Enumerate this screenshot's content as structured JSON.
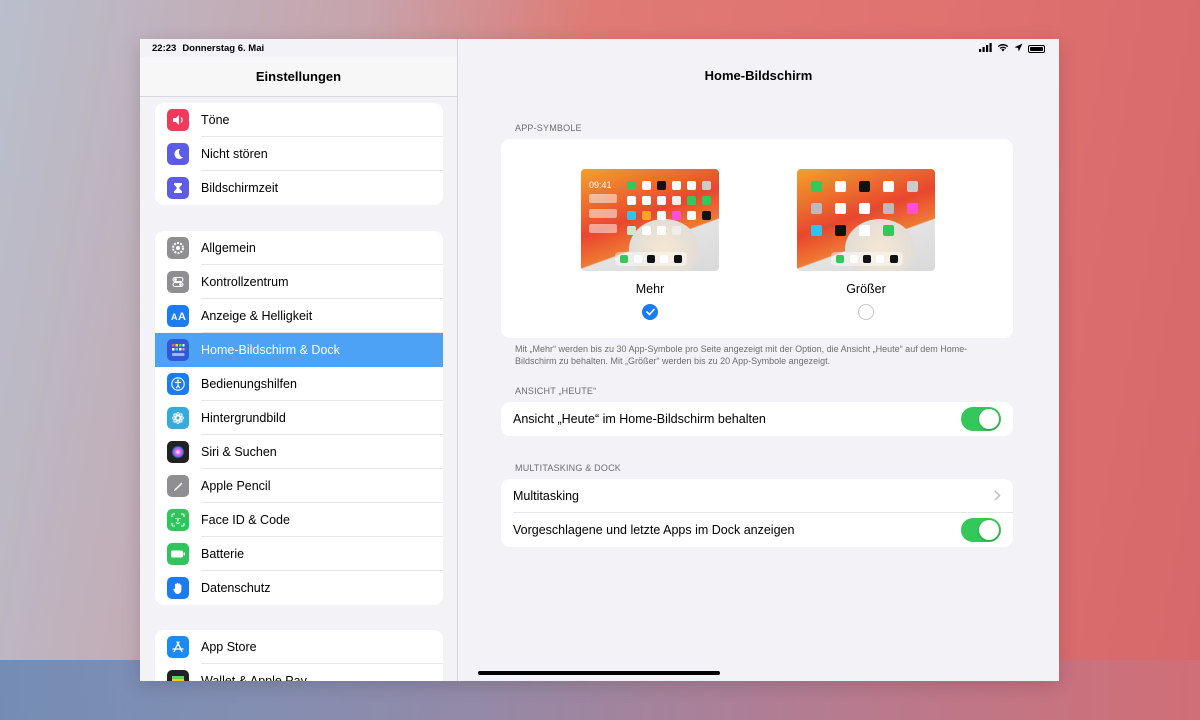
{
  "status": {
    "time": "22:23",
    "date": "Donnerstag 6. Mai"
  },
  "sidebar": {
    "title": "Einstellungen",
    "groups": [
      {
        "items": [
          {
            "label": "Töne",
            "icon": "speaker-icon",
            "color": "#f2395b"
          },
          {
            "label": "Nicht stören",
            "icon": "moon-icon",
            "color": "#5e5ce6"
          },
          {
            "label": "Bildschirmzeit",
            "icon": "hourglass-icon",
            "color": "#5e5ce6"
          }
        ]
      },
      {
        "items": [
          {
            "label": "Allgemein",
            "icon": "gear-icon",
            "color": "#8e8e93"
          },
          {
            "label": "Kontrollzentrum",
            "icon": "toggles-icon",
            "color": "#8e8e93"
          },
          {
            "label": "Anzeige & Helligkeit",
            "icon": "text-size-icon",
            "color": "#1a7cf0"
          },
          {
            "label": "Home-Bildschirm & Dock",
            "icon": "home-grid-icon",
            "color": "#2f59d7",
            "selected": true
          },
          {
            "label": "Bedienungshilfen",
            "icon": "accessibility-icon",
            "color": "#1a7cf0"
          },
          {
            "label": "Hintergrundbild",
            "icon": "flower-icon",
            "color": "#35aadc"
          },
          {
            "label": "Siri & Suchen",
            "icon": "siri-icon",
            "color": "#222"
          },
          {
            "label": "Apple Pencil",
            "icon": "pencil-icon",
            "color": "#8e8e93"
          },
          {
            "label": "Face ID & Code",
            "icon": "face-id-icon",
            "color": "#30c45c"
          },
          {
            "label": "Batterie",
            "icon": "battery-icon",
            "color": "#30c45c"
          },
          {
            "label": "Datenschutz",
            "icon": "hand-icon",
            "color": "#1a7cf0"
          }
        ]
      },
      {
        "items": [
          {
            "label": "App Store",
            "icon": "app-store-icon",
            "color": "#1a8af5"
          },
          {
            "label": "Wallet & Apple Pay",
            "icon": "wallet-icon",
            "color": "#222"
          }
        ]
      }
    ]
  },
  "detail": {
    "title": "Home-Bildschirm",
    "app_icons_section": "APP-SYMBOLE",
    "option_more": "Mehr",
    "option_bigger": "Größer",
    "preview_time": "09:41",
    "footnote": "Mit „Mehr“ werden bis zu 30 App-Symbole pro Seite angezeigt mit der Option, die Ansicht „Heute“ auf dem Home-Bildschirm zu behalten. Mit „Größer“ werden bis zu 20 App-Symbole angezeigt.",
    "today_section": "ANSICHT „HEUTE“",
    "today_row": "Ansicht „Heute“ im Home-Bildschirm behalten",
    "today_toggle": true,
    "multitasking_section": "MULTITASKING & DOCK",
    "multitasking_row": "Multitasking",
    "suggested_row": "Vorgeschlagene und letzte Apps im Dock anzeigen",
    "suggested_toggle": true,
    "selected_option": "Mehr"
  }
}
